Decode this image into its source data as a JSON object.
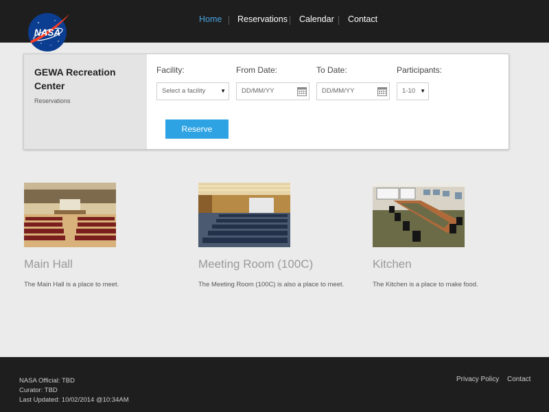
{
  "nav": {
    "items": [
      {
        "label": "Home",
        "active": true
      },
      {
        "label": "Reservations",
        "active": false
      },
      {
        "label": "Calendar",
        "active": false
      },
      {
        "label": "Contact",
        "active": false
      }
    ]
  },
  "logo": {
    "text": "NASA"
  },
  "panel": {
    "title": "GEWA Recreation Center",
    "subtitle": "Reservations",
    "facility_label": "Facility:",
    "facility_value": "Select a facility",
    "from_label": "From Date:",
    "from_placeholder": "DD/MM/YY",
    "to_label": "To Date:",
    "to_placeholder": "DD/MM/YY",
    "participants_label": "Participants:",
    "participants_value": "1-10",
    "reserve_label": "Reserve"
  },
  "facilities": [
    {
      "title": "Main Hall",
      "description": "The Main Hall is a place to meet."
    },
    {
      "title": "Meeting Room (100C)",
      "description": "The Meeting Room (100C) is also a place to meet."
    },
    {
      "title": "Kitchen",
      "description": "The Kitchen is a place to make food."
    }
  ],
  "footer": {
    "official": "NASA Official: TBD",
    "curator": "Curator: TBD",
    "updated": "Last Updated: 10/02/2014 @10:34AM",
    "privacy": "Privacy Policy",
    "contact": "Contact"
  },
  "colors": {
    "accent": "#2ea3e3",
    "nav_active": "#4aa3df",
    "header_bg": "#1e1e1e",
    "page_bg": "#ebebeb"
  }
}
